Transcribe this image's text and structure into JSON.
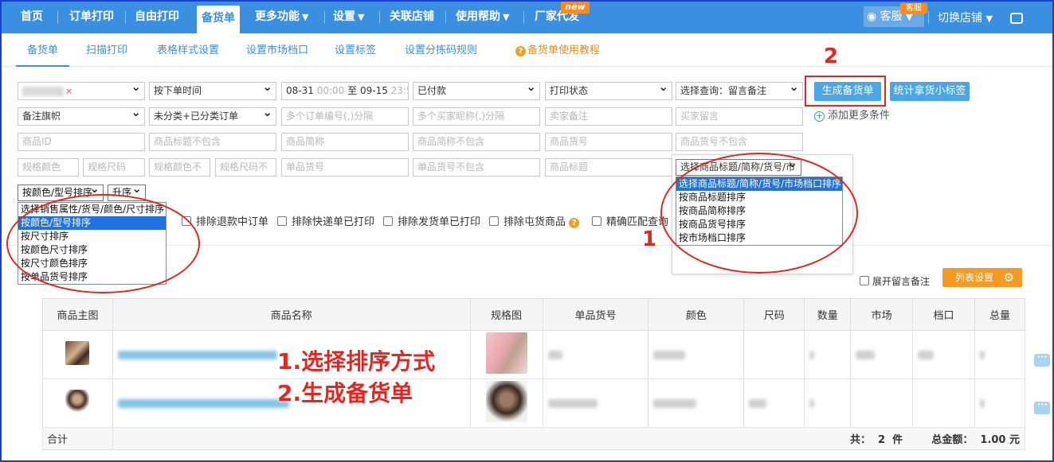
{
  "nav": {
    "items": [
      "首页",
      "订单打印",
      "自由打印",
      "备货单",
      "更多功能",
      "设置",
      "关联店铺",
      "使用帮助",
      "厂家代发"
    ],
    "new_badge": "new",
    "kefu_label": "客服",
    "kefu_badge": "客服",
    "switch_store": "切换店铺"
  },
  "subtabs": {
    "items": [
      "备货单",
      "扫描打印",
      "表格样式设置",
      "设置市场档口",
      "设置标签",
      "设置分拣码规则"
    ],
    "tutorial": "备货单使用教程"
  },
  "filters": {
    "order_time": "按下单时间",
    "date_start": "08-31",
    "time_start": "00:00",
    "date_sep": "至",
    "date_end": "09-15",
    "time_end": "23:59",
    "pay_status": "已付款",
    "print_status": "打印状态",
    "query_select": "选择查询：留言备注",
    "flag_select": "备注旗帜",
    "classify_select": "未分类+已分类订单",
    "ph_order_no": "多个订单编号(,)分隔",
    "ph_buyer_nick": "多个买家昵称(,)分隔",
    "ph_seller_memo": "卖家备注",
    "ph_buyer_msg": "买家留言",
    "ph_product_id": "商品ID",
    "ph_title_exclude": "商品标题不包含",
    "ph_short_name": "商品简称",
    "ph_short_exclude": "商品简称不包含",
    "ph_product_code": "商品货号",
    "ph_code_exclude": "商品货号不包含",
    "ph_spec_color": "规格颜色",
    "ph_spec_size": "规格尺码",
    "ph_color_exclude": "规格颜色不",
    "ph_size_exclude": "规格尺码不",
    "ph_sku_code": "单品货号",
    "ph_sku_exclude": "单品货号不包含",
    "ph_product_title": "商品标题",
    "sort_select": "按颜色/型号排序",
    "order_select": "升序",
    "right_sort_select": "选择商品标题/简称/货号/市"
  },
  "buttons": {
    "generate": "生成备货单",
    "stats": "统计拿货小标签",
    "add_more": "添加更多条件"
  },
  "left_sort_options": [
    "选择销售属性/货号/颜色/尺寸排序",
    "按颜色/型号排序",
    "按尺寸排序",
    "按颜色尺寸排序",
    "按尺寸颜色排序",
    "按单品货号排序"
  ],
  "right_sort_options": [
    "选择商品标题/简称/货号/市场档口排序",
    "按商品标题排序",
    "按商品简称排序",
    "按商品货号排序",
    "按市场档口排序"
  ],
  "checkboxes": [
    "排除退款中订单",
    "排除快递单已打印",
    "排除发货单已打印",
    "排除屯货商品",
    "精确匹配查询"
  ],
  "expand_note": "展开留言备注",
  "column_settings": "列表设置",
  "table": {
    "headers": [
      "商品主图",
      "商品名称",
      "规格图",
      "单品货号",
      "颜色",
      "尺码",
      "数量",
      "市场",
      "档口",
      "总量"
    ],
    "total_label": "合计",
    "count_text": "共：  2  件",
    "amount_text": "总金额：  1.00 元"
  },
  "annotations": {
    "marker_1": "1",
    "marker_2": "2",
    "step_1": "1.选择排序方式",
    "step_2": "2.生成备货单",
    "accent": "#e52620"
  },
  "colors": {
    "nav_bg": "#3b8fe0",
    "button_blue": "#4aa6ea",
    "orange": "#f59a23",
    "highlight": "#1e72e6"
  }
}
